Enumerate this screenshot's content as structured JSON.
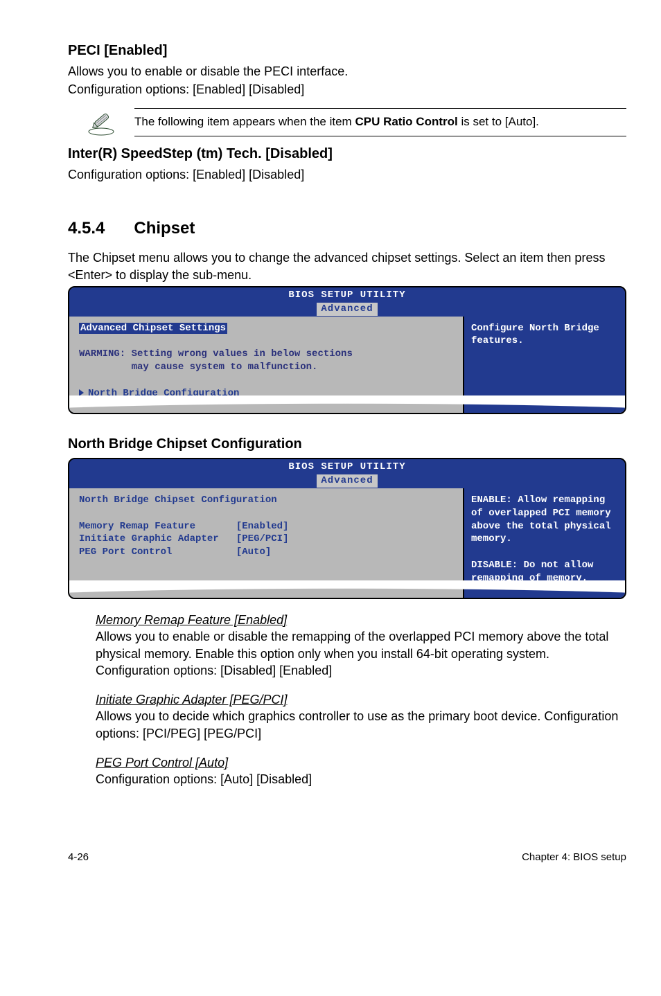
{
  "peci": {
    "title": "PECI [Enabled]",
    "line1": "Allows you to enable or disable the PECI interface.",
    "line2": "Configuration options: [Enabled] [Disabled]"
  },
  "note": {
    "text_prefix": "The following item appears when the item ",
    "bold": "CPU Ratio Control",
    "text_suffix": " is set to [Auto]."
  },
  "speedstep": {
    "title": "Inter(R) SpeedStep (tm) Tech. [Disabled]",
    "line1": "Configuration options: [Enabled] [Disabled]"
  },
  "chipset": {
    "num": "4.5.4",
    "title": "Chipset",
    "para": "The Chipset menu allows you to change the advanced chipset settings. Select an item then press <Enter> to display the sub-menu."
  },
  "bios1": {
    "utility": "BIOS SETUP UTILITY",
    "tab": "Advanced",
    "heading": "Advanced Chipset Settings",
    "warn1": "WARMING: Setting wrong values in below sections",
    "warn2": "         may cause system to malfunction.",
    "submenu": "North Bridge Configuration",
    "help": "Configure North Bridge features."
  },
  "nb_title": "North Bridge Chipset Configuration",
  "bios2": {
    "utility": "BIOS SETUP UTILITY",
    "tab": "Advanced",
    "heading": "North Bridge Chipset Configuration",
    "row1_label": "Memory Remap Feature",
    "row1_val": "[Enabled]",
    "row2_label": "Initiate Graphic Adapter",
    "row2_val": "[PEG/PCI]",
    "row3_label": "PEG Port Control",
    "row3_val": "[Auto]",
    "help1": "ENABLE: Allow remapping of overlapped PCI memory above the total physical memory.",
    "help2": "DISABLE: Do not allow remapping of memory."
  },
  "memremap": {
    "title": "Memory Remap Feature [Enabled]",
    "para": "Allows you to enable or disable the remapping of the overlapped PCI memory above the total physical memory. Enable this option only when you install 64-bit operating system. Configuration options: [Disabled] [Enabled]"
  },
  "initgfx": {
    "title": "Initiate Graphic Adapter [PEG/PCI]",
    "para": "Allows you to decide which graphics controller to use as the primary boot device. Configuration options: [PCI/PEG] [PEG/PCI]"
  },
  "pegport": {
    "title": "PEG Port Control [Auto]",
    "para": "Configuration options: [Auto] [Disabled]"
  },
  "footer": {
    "left": "4-26",
    "right": "Chapter 4: BIOS setup"
  }
}
